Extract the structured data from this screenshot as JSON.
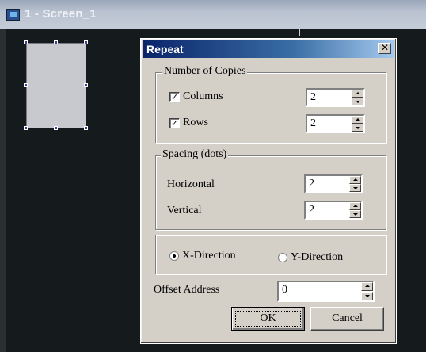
{
  "background_window": {
    "title": "1 - Screen_1",
    "icon": "screen-window-icon"
  },
  "dialog": {
    "title": "Repeat",
    "close_glyph": "✕",
    "copies": {
      "label": "Number of Copies",
      "columns": {
        "label": "Columns",
        "checked": true,
        "value": "2"
      },
      "rows": {
        "label": "Rows",
        "checked": true,
        "value": "2"
      }
    },
    "spacing": {
      "label": "Spacing (dots)",
      "horizontal": {
        "label": "Horizontal",
        "value": "2"
      },
      "vertical": {
        "label": "Vertical",
        "value": "2"
      }
    },
    "direction": {
      "x": {
        "label": "X-Direction",
        "selected": true
      },
      "y": {
        "label": "Y-Direction",
        "selected": false
      }
    },
    "offset": {
      "label": "Offset Address",
      "value": "0"
    },
    "ok_label": "OK",
    "cancel_label": "Cancel",
    "check_glyph": "✓"
  }
}
